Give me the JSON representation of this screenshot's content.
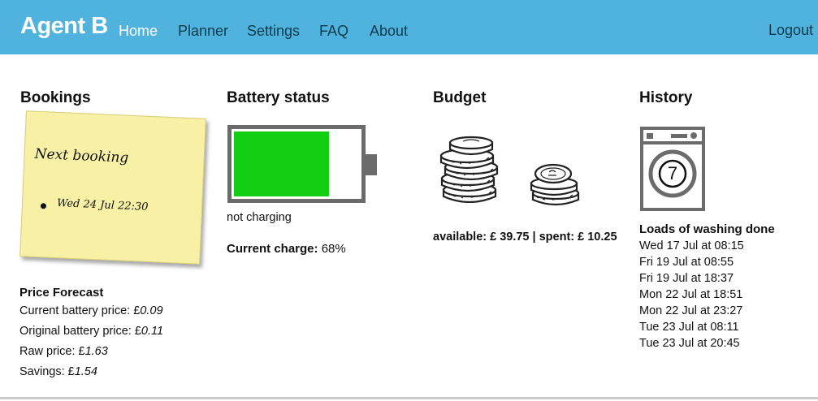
{
  "nav": {
    "brand": "Agent B",
    "links": [
      "Home",
      "Planner",
      "Settings",
      "FAQ",
      "About"
    ],
    "active": "Home",
    "logout": "Logout",
    "bar_color": "#4fb3de"
  },
  "bookings": {
    "title": "Bookings",
    "note_title": "Next booking",
    "items": [
      "Wed 24 Jul 22:30"
    ]
  },
  "price_forecast": {
    "title": "Price Forecast",
    "current_battery_price_label": "Current battery price: £",
    "current_battery_price_value": "0.09",
    "original_battery_price_label": "Original battery price: £",
    "original_battery_price_value": "0.11",
    "raw_price_label": "Raw price: £",
    "raw_price_value": "1.63",
    "savings_label": "Savings: £",
    "savings_value": "1.54"
  },
  "battery": {
    "title": "Battery status",
    "charge_fraction": 0.68,
    "status": "not charging",
    "current_charge_label": "Current charge:",
    "current_charge_value": "68%",
    "fill_color": "#13cf13"
  },
  "budget": {
    "title": "Budget",
    "summary": "available: £ 39.75 | spent: £ 10.25"
  },
  "history": {
    "title": "History",
    "washer_count": "7",
    "subtitle": "Loads of washing done",
    "items": [
      "Wed 17 Jul at 08:15",
      "Fri 19 Jul at 08:55",
      "Fri 19 Jul at 18:37",
      "Mon 22 Jul at 18:51",
      "Mon 22 Jul at 23:27",
      "Tue 23 Jul at 08:11",
      "Tue 23 Jul at 20:45"
    ]
  }
}
